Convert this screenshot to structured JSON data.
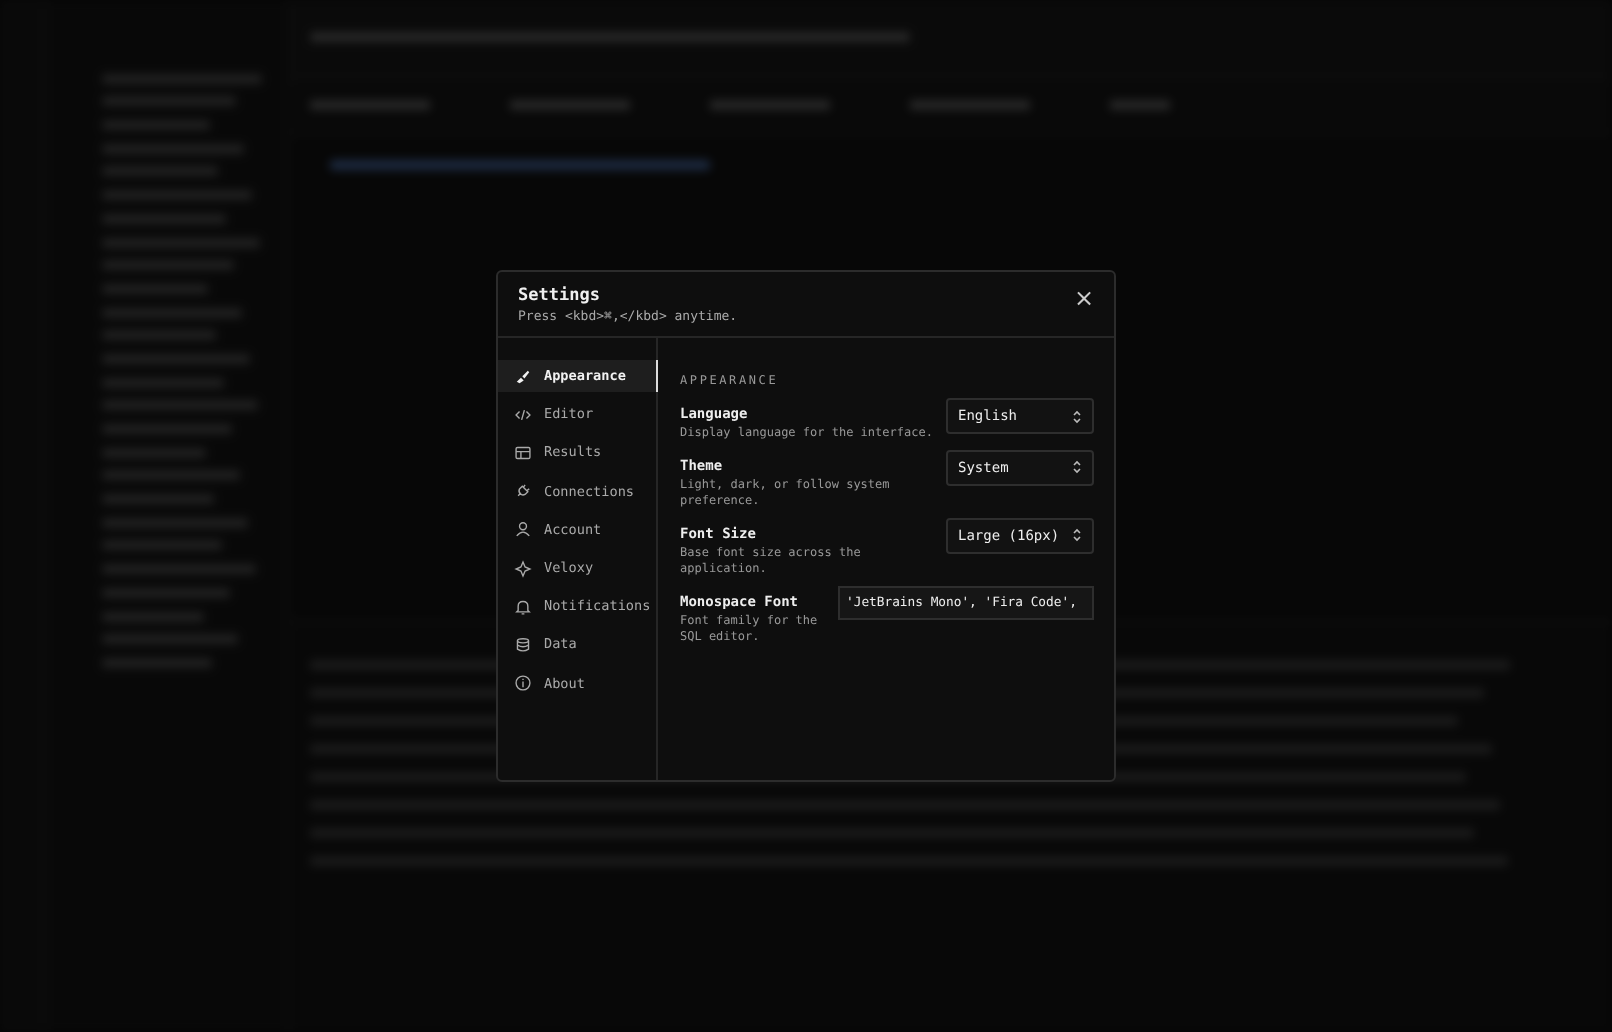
{
  "dialog": {
    "title": "Settings",
    "subtitle": "Press <kbd>⌘,</kbd> anytime.",
    "close": "×",
    "nav": [
      {
        "label": "Appearance",
        "selected": true
      },
      {
        "label": "Editor",
        "selected": false
      },
      {
        "label": "Results",
        "selected": false
      },
      {
        "label": "Connections",
        "selected": false
      },
      {
        "label": "Account",
        "selected": false
      },
      {
        "label": "Veloxy",
        "selected": false
      },
      {
        "label": "Notifications",
        "selected": false
      },
      {
        "label": "Data",
        "selected": false
      },
      {
        "label": "About",
        "selected": false
      }
    ],
    "section": "APPEARANCE",
    "settings": [
      {
        "kind": "select",
        "label": "Language",
        "description": "Display language for the interface.",
        "value": "English"
      },
      {
        "kind": "select",
        "label": "Theme",
        "description": "Light, dark, or follow system preference.",
        "value": "System"
      },
      {
        "kind": "select",
        "label": "Font Size",
        "description": "Base font size across the application.",
        "value": "Large (16px)"
      },
      {
        "kind": "input",
        "label": "Monospace Font",
        "description": "Font family for the SQL editor.",
        "value": "'JetBrains Mono', 'Fira Code',"
      }
    ]
  }
}
